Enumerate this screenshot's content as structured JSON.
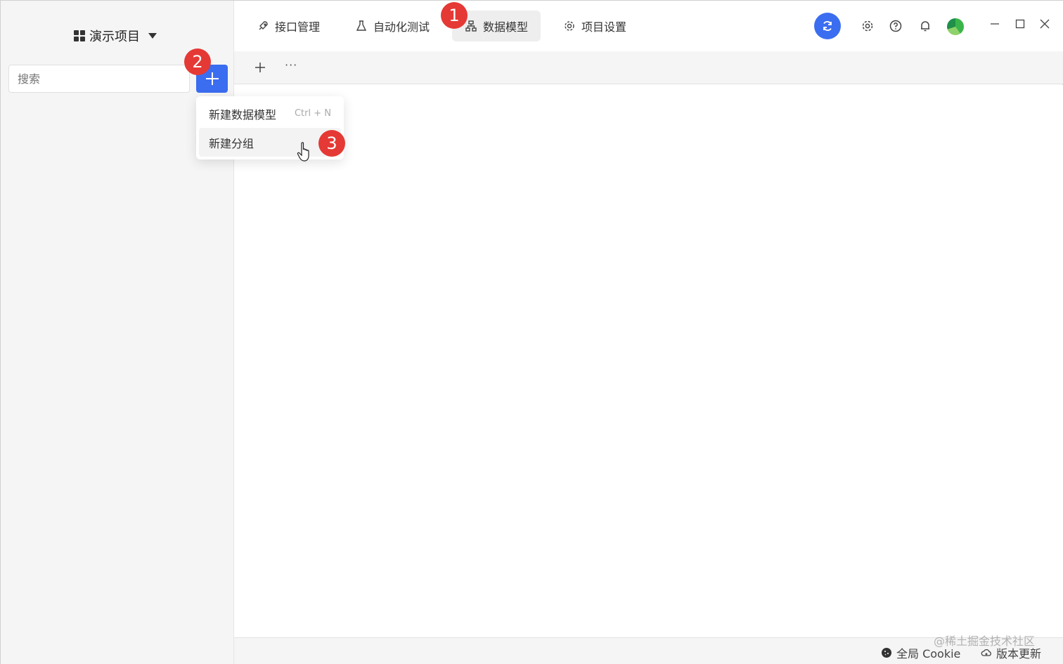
{
  "sidebar": {
    "project_name": "演示项目",
    "search_placeholder": "搜索"
  },
  "dropdown": {
    "items": [
      {
        "label": "新建数据模型",
        "shortcut": "Ctrl + N"
      },
      {
        "label": "新建分组",
        "shortcut": ""
      }
    ]
  },
  "tabs": [
    {
      "label": "接口管理",
      "icon": "rocket-icon"
    },
    {
      "label": "自动化测试",
      "icon": "flask-icon"
    },
    {
      "label": "数据模型",
      "icon": "model-icon",
      "active": true
    },
    {
      "label": "项目设置",
      "icon": "gear-icon"
    }
  ],
  "toolbar": {
    "more": "···"
  },
  "statusbar": {
    "cookie_label": "全局 Cookie",
    "update_label": "版本更新",
    "watermark": "@稀土掘金技术社区"
  },
  "badges": [
    "1",
    "2",
    "3"
  ],
  "colors": {
    "accent": "#3b6df0",
    "badge": "#e53935"
  }
}
